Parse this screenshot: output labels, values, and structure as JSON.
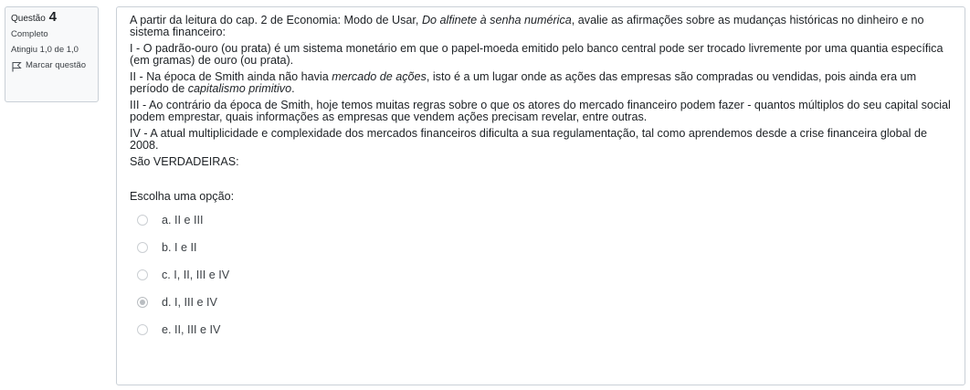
{
  "info": {
    "question_prefix": "Questão",
    "question_number": "4",
    "state": "Completo",
    "grade": "Atingiu 1,0 de 1,0",
    "flag_label": "Marcar questão",
    "flag_icon": "flag-icon"
  },
  "question": {
    "intro_start": "A partir da leitura do cap. 2 de Economia: Modo de Usar, ",
    "intro_italic": "Do alfinete à senha numérica",
    "intro_end": ", avalie as afirmações sobre as mudanças históricas no dinheiro e no sistema financeiro:",
    "item1": "I - O padrão-ouro (ou prata) é um sistema monetário em que o papel-moeda emitido pelo banco central pode ser trocado livremente por uma quantia específica (em gramas) de ouro (ou prata).",
    "item2_start": "II - Na época de Smith ainda não havia ",
    "item2_italic1": "mercado de ações",
    "item2_mid": ", isto é a um lugar onde as ações das empresas são compradas ou vendidas, pois ainda era um período de ",
    "item2_italic2": "capitalismo primitivo",
    "item2_end": ".",
    "item3": "III - Ao contrário da época de Smith, hoje temos muitas regras sobre o que os atores do mercado financeiro podem fazer - quantos múltiplos do seu capital social podem emprestar, quais informações as empresas que vendem ações precisam revelar, entre outras.",
    "item4": "IV - A atual multiplicidade e complexidade dos mercados financeiros dificulta a sua regulamentação, tal como aprendemos desde a crise financeira global de 2008.",
    "closing": "São VERDADEIRAS:"
  },
  "answer": {
    "prompt": "Escolha uma opção:",
    "options": [
      {
        "label": "a. II e III",
        "selected": false
      },
      {
        "label": "b. I e II",
        "selected": false
      },
      {
        "label": "c. I, II, III e IV",
        "selected": false
      },
      {
        "label": "d. I, III e IV",
        "selected": true
      },
      {
        "label": "e. II, III e IV",
        "selected": false
      }
    ]
  }
}
